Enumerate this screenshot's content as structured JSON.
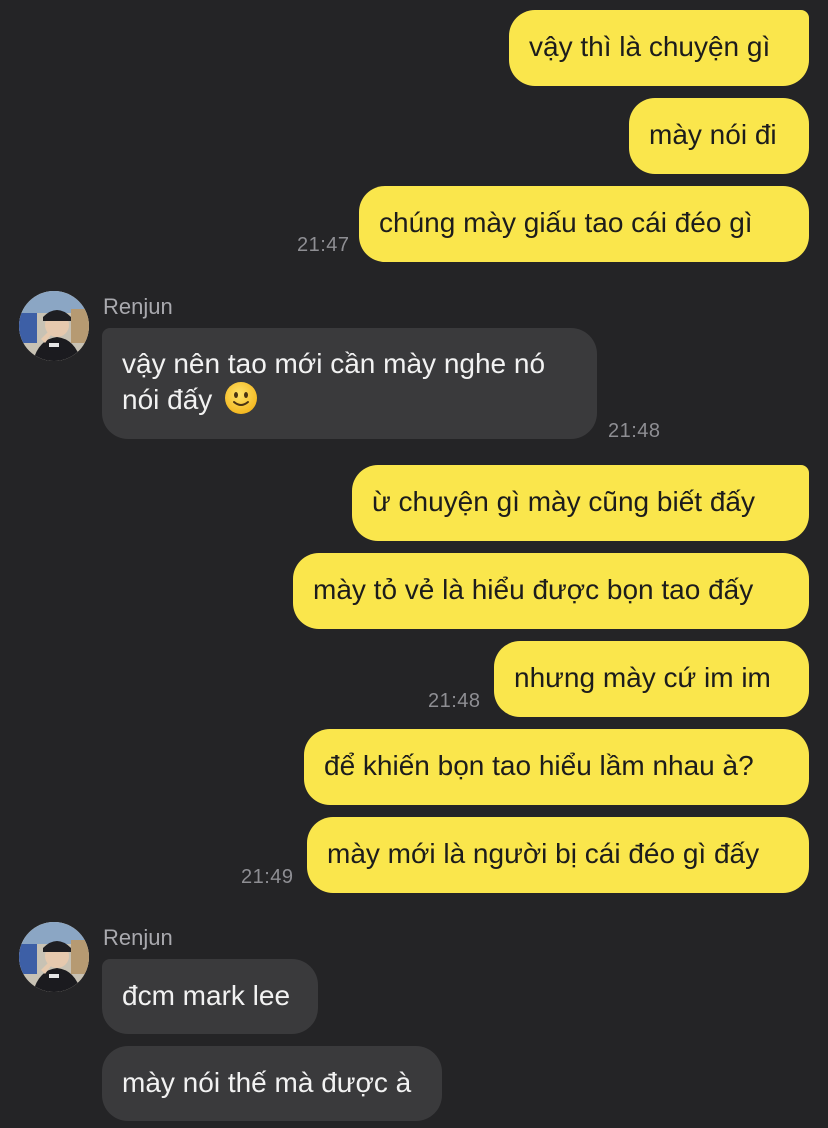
{
  "messages": {
    "m1": "vậy thì là chuyện gì",
    "m2": "mày nói đi",
    "m3": "chúng mày giấu tao cái đéo gì",
    "t1": "21:47",
    "s1": "Renjun",
    "r1": "vậy nên tao mới cần mày nghe nó nói đấy",
    "t2": "21:48",
    "m4": "ừ chuyện gì mày cũng biết đấy",
    "m5": "mày tỏ vẻ là hiểu được bọn tao đấy",
    "m6": "nhưng mày cứ im im",
    "t3": "21:48",
    "m7": "để khiến bọn tao hiểu lầm nhau à?",
    "m8": "mày mới là người bị cái đéo gì đấy",
    "t4": "21:49",
    "s2": "Renjun",
    "r2": "đcm mark lee",
    "r3": "mày nói thế mà được à"
  },
  "colors": {
    "background": "#242426",
    "my_bubble": "#fae64c",
    "their_bubble": "#3a3a3c",
    "timestamp": "#8e8e93"
  },
  "icons": {
    "r1_emoji": "slightly-smiling-face-icon"
  }
}
